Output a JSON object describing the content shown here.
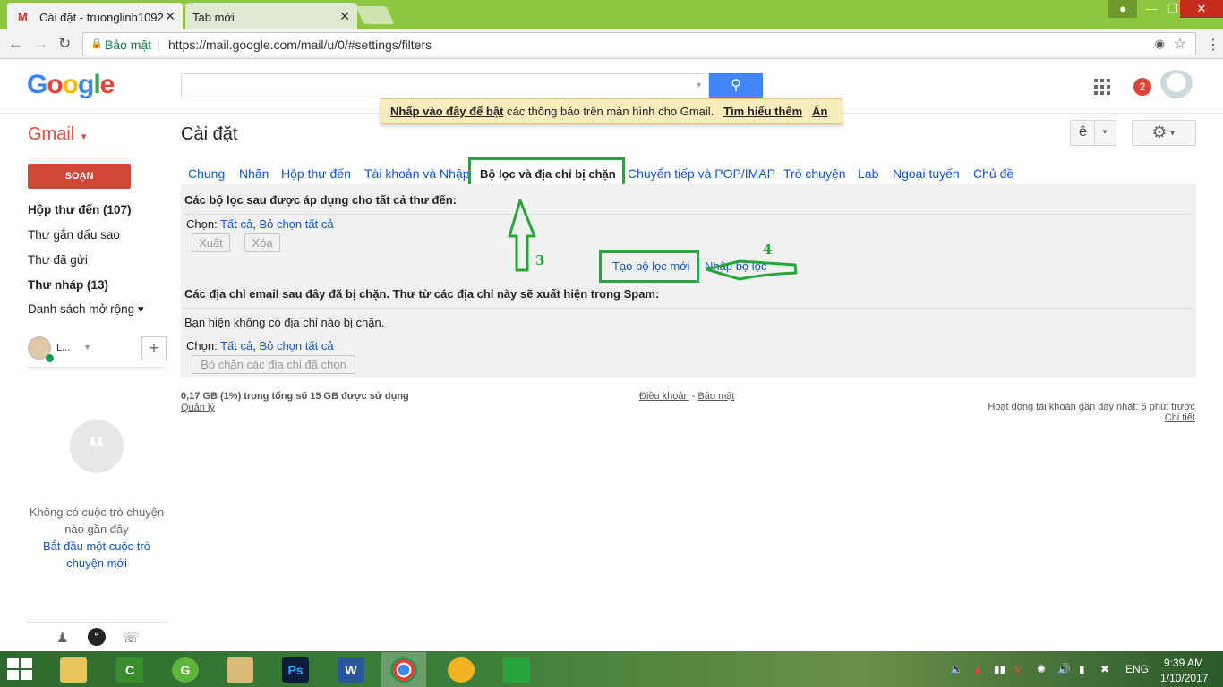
{
  "browser": {
    "tabs": [
      {
        "label": "Cài đặt - truonglinh1092",
        "close": "✕"
      },
      {
        "label": "Tab mới",
        "close": "✕"
      }
    ],
    "secure_label": "Bảo mật",
    "url": "https://mail.google.com/mail/u/0/#settings/filters"
  },
  "header": {
    "logo": [
      "G",
      "o",
      "o",
      "g",
      "l",
      "e"
    ],
    "search_placeholder": "",
    "notifications_count": "2"
  },
  "notice": {
    "enable_link": "Nhấp vào đây để bật",
    "text": " các thông báo trên màn hình cho Gmail.",
    "learn_more": "Tìm hiểu thêm",
    "hide": "Ẩn"
  },
  "gmail": {
    "brand": "Gmail",
    "page_title": "Cài đặt",
    "input_tool": "ê"
  },
  "sidebar": {
    "compose": "SOẠN",
    "items": [
      {
        "label": "Hộp thư đến (107)",
        "bold": true
      },
      {
        "label": "Thư gắn dấu sao",
        "bold": false
      },
      {
        "label": "Thư đã gửi",
        "bold": false
      },
      {
        "label": "Thư nháp (13)",
        "bold": true
      },
      {
        "label": "Danh sách mở rộng ▾",
        "bold": false
      }
    ],
    "hangouts_user": "L...",
    "no_chats": "Không có cuộc trò chuyện nào gần đây",
    "start_chat": "Bắt đầu một cuộc trò chuyện mới"
  },
  "settings_tabs": [
    "Chung",
    "Nhãn",
    "Hộp thư đến",
    "Tài khoản và Nhập",
    "Bộ lọc và địa chỉ bị chặn",
    "Chuyển tiếp và POP/IMAP",
    "Trò chuyện",
    "Lab",
    "Ngoại tuyến",
    "Chủ đề"
  ],
  "filters": {
    "heading": "Các bộ lọc sau được áp dụng cho tất cả thư đến:",
    "select_label": "Chọn: ",
    "select_all": "Tất cả",
    "select_none": "Bỏ chọn tất cả",
    "export_btn": "Xuất",
    "delete_btn": "Xóa",
    "create_new": "Tạo bộ lọc mới",
    "import": "Nhập bộ lọc"
  },
  "blocked": {
    "heading": "Các địa chỉ email sau đây đã bị chặn. Thư từ các địa chỉ này sẽ xuất hiện trong Spam:",
    "empty": "Bạn hiện không có địa chỉ nào bị chặn.",
    "select_label": "Chọn: ",
    "select_all": "Tất cả",
    "select_none": "Bỏ chọn tất cả",
    "unblock_btn": "Bỏ chặn các địa chỉ đã chọn"
  },
  "annotations": {
    "step3": "3",
    "step4": "4"
  },
  "footer": {
    "storage": "0,17 GB (1%) trong tổng số 15 GB được sử dụng",
    "manage": "Quản lý",
    "terms": "Điều khoản",
    "privacy": "Bảo mật",
    "activity": "Hoạt động tài khoản gần đây nhất: 5 phút trước",
    "details": "Chi tiết"
  },
  "taskbar": {
    "apps": [
      "File Explorer",
      "Camtasia",
      "Greenshot",
      "Paint",
      "Ps",
      "W",
      "Chrome",
      "Network",
      "Presentation"
    ],
    "lang": "ENG",
    "time": "9:39 AM",
    "date": "1/10/2017"
  },
  "colors": {
    "accent_green": "#2aa53d",
    "compose_red": "#d14836",
    "link_blue": "#1155cc",
    "brand_red": "#dd4b39"
  }
}
